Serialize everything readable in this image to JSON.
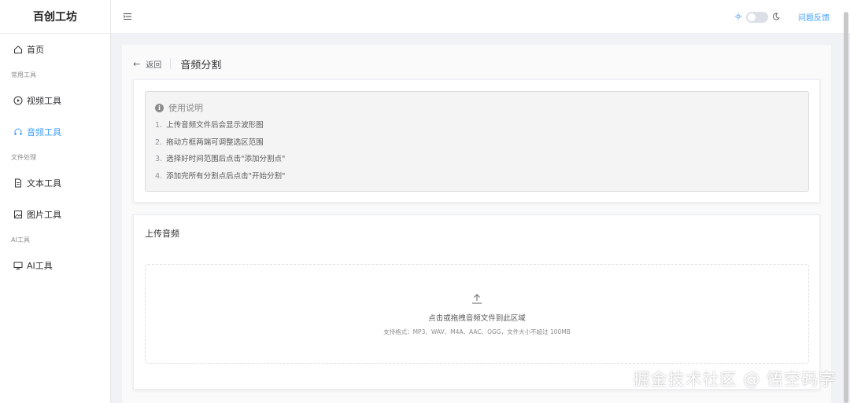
{
  "app": {
    "title": "百创工坊"
  },
  "sidebar": {
    "home": "首页",
    "groups": [
      {
        "label": "常用工具",
        "items": [
          {
            "label": "视频工具",
            "icon": "play-circle-icon"
          },
          {
            "label": "音频工具",
            "icon": "headphones-icon",
            "active": true
          }
        ]
      },
      {
        "label": "文件处理",
        "items": [
          {
            "label": "文本工具",
            "icon": "document-icon"
          },
          {
            "label": "图片工具",
            "icon": "image-icon"
          }
        ]
      },
      {
        "label": "AI工具",
        "items": [
          {
            "label": "AI工具",
            "icon": "monitor-icon"
          }
        ]
      }
    ]
  },
  "header": {
    "feedback": "问题反馈",
    "theme_toggle": "light"
  },
  "page": {
    "back": "返回",
    "title": "音频分割",
    "instructions": {
      "title": "使用说明",
      "steps": [
        {
          "num": "1.",
          "text": "上传音频文件后会显示波形图"
        },
        {
          "num": "2.",
          "text": "拖动方框两端可调整选区范围"
        },
        {
          "num": "3.",
          "text": "选择好时间范围后点击\"添加分割点\""
        },
        {
          "num": "4.",
          "text": "添加完所有分割点后点击\"开始分割\""
        }
      ]
    },
    "upload": {
      "title": "上传音频",
      "main_text": "点击或拖拽音频文件到此区域",
      "sub_text": "支持格式：MP3、WAV、M4A、AAC、OGG，文件大小不超过 100MB"
    }
  },
  "watermark": "掘金技术社区 @ 悟空码字",
  "colors": {
    "accent": "#409eff"
  }
}
